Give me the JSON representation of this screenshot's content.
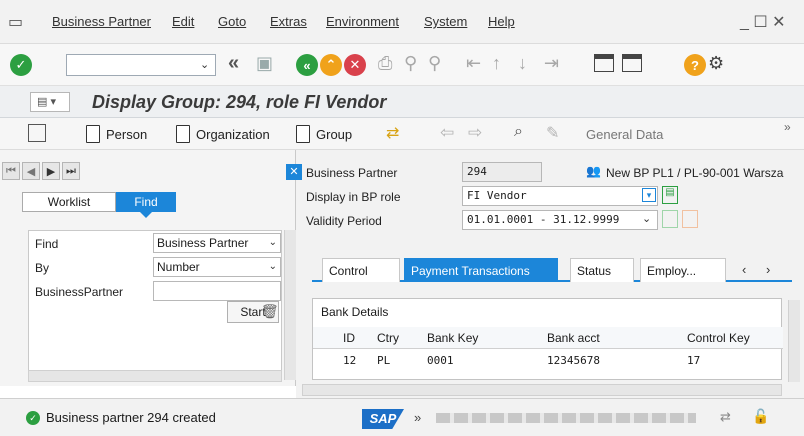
{
  "menu": {
    "items": [
      "Business Partner",
      "Edit",
      "Goto",
      "Extras",
      "Environment",
      "System",
      "Help"
    ],
    "window_controls": "_ ☐ ✕"
  },
  "toolbar": {
    "command_field_value": "",
    "icons": [
      "enter-icon",
      "back-double-icon",
      "save-icon",
      "back-icon",
      "exit-icon",
      "cancel-icon",
      "print-icon",
      "find-icon",
      "find-next-icon",
      "first-page-icon",
      "prev-page-icon",
      "next-page-icon",
      "last-page-icon",
      "new-session-icon",
      "shortcut-icon",
      "help-icon",
      "settings-icon"
    ]
  },
  "title": {
    "text": "Display Group: 294, role FI Vendor"
  },
  "toolbar2": {
    "person": "Person",
    "organization": "Organization",
    "group": "Group",
    "general_data": "General Data"
  },
  "left": {
    "tabs": {
      "worklist": "Worklist",
      "find": "Find"
    },
    "rows": [
      {
        "label": "Find",
        "value": "Business Partner"
      },
      {
        "label": "By",
        "value": "Number"
      },
      {
        "label": "BusinessPartner",
        "value": ""
      }
    ],
    "start": "Start"
  },
  "header": {
    "bp_label": "Business Partner",
    "bp_value": "294",
    "bp_desc": "New BP PL1 / PL-90-001 Warsza",
    "role_label": "Display in BP role",
    "role_value": "FI Vendor",
    "validity_label": "Validity Period",
    "validity_value": "01.01.0001 - 31.12.9999"
  },
  "tabs": [
    "Control",
    "Payment Transactions",
    "Status",
    "Employ..."
  ],
  "bank": {
    "title": "Bank Details",
    "columns": [
      "ID",
      "Ctry",
      "Bank Key",
      "Bank acct",
      "Control Key"
    ],
    "rows": [
      [
        "12",
        "PL",
        "0001",
        "12345678",
        "17"
      ]
    ]
  },
  "status": {
    "message": "Business partner 294 created",
    "sap": "SAP"
  },
  "colors": {
    "accent": "#1c86d9",
    "ok": "#2c9f41",
    "exit": "#f0a21b",
    "cancel": "#d9414b"
  }
}
